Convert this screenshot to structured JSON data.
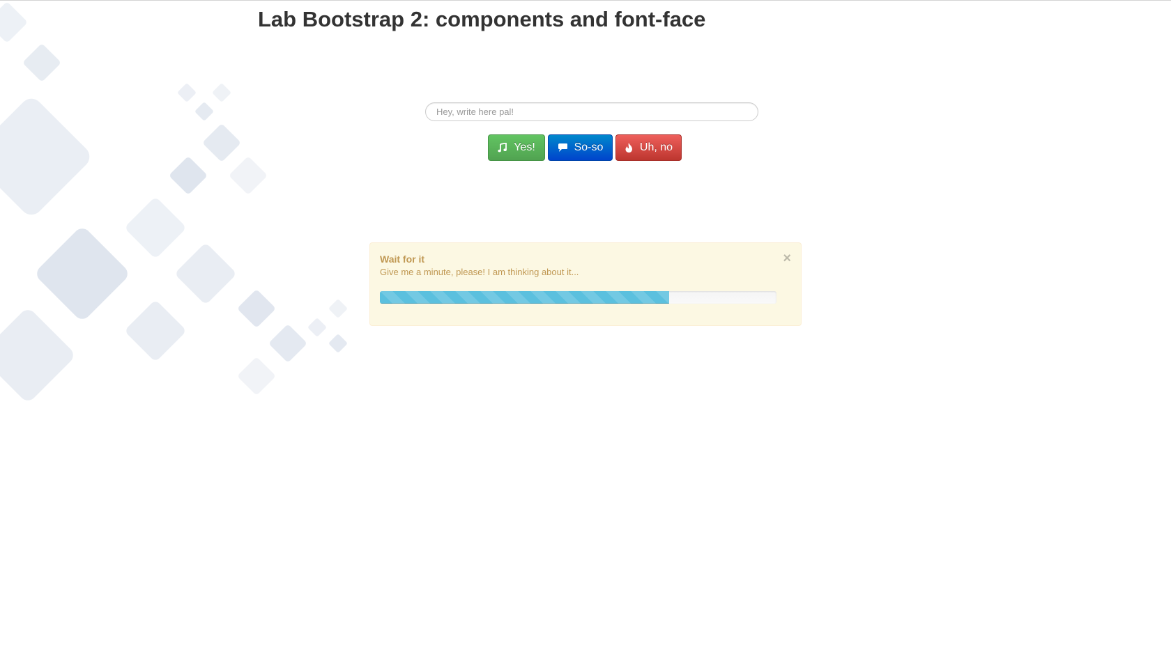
{
  "page": {
    "title": "Lab Bootstrap 2: components and font-face"
  },
  "search": {
    "placeholder": "Hey, write here pal!",
    "value": ""
  },
  "buttons": {
    "yes": {
      "label": "Yes!",
      "icon": "music-note-icon",
      "color": "#5bb75b"
    },
    "soso": {
      "label": "So-so",
      "icon": "speech-bubble-icon",
      "color": "#006dcc"
    },
    "no": {
      "label": "Uh, no",
      "icon": "fire-icon",
      "color": "#da4f49"
    }
  },
  "alert": {
    "heading": "Wait for it",
    "message": "Give me a minute, please! I am thinking about it...",
    "close_glyph": "×",
    "close_icon": "close-icon",
    "progress_percent": 73,
    "progress_color": "#5bc0de"
  },
  "colors": {
    "alert_background": "#fcf8e3",
    "alert_text": "#c09853",
    "pattern_tile": "#dfe5ee"
  }
}
